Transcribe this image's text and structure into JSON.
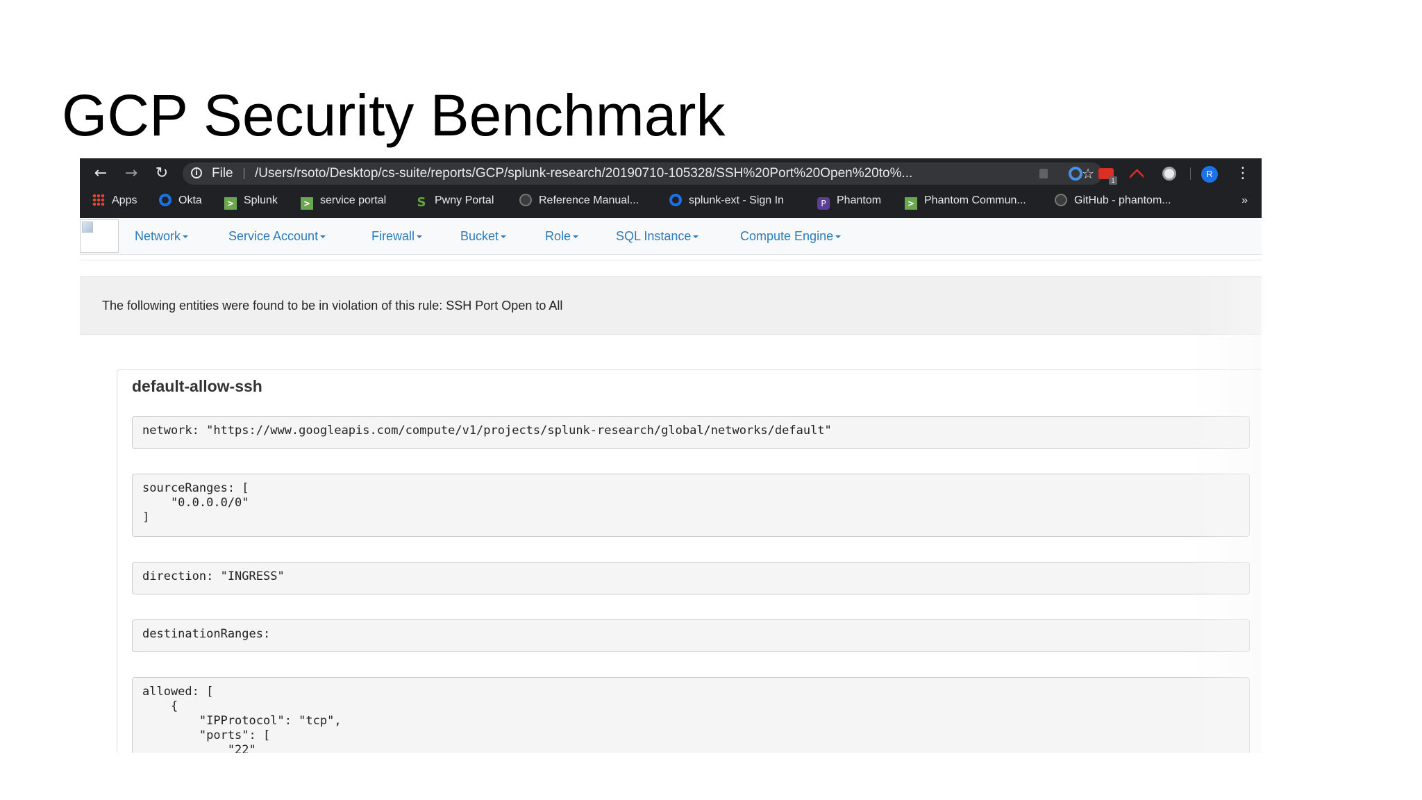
{
  "slide": {
    "title": "GCP Security Benchmark"
  },
  "browser": {
    "toolbar": {
      "back_icon": "←",
      "forward_icon": "→",
      "reload_icon": "↻",
      "file_label": "File",
      "url": "/Users/rsoto/Desktop/cs-suite/reports/GCP/splunk-research/20190710-105328/SSH%20Port%20Open%20to%...",
      "star_icon": "☆",
      "avatar_initial": "R",
      "menu_icon": "⋮",
      "extension_badge": "1"
    },
    "bookmarks": [
      {
        "label": "Apps",
        "icon": "apps-grid-icon"
      },
      {
        "label": "Okta",
        "icon": "okta-icon"
      },
      {
        "label": "Splunk",
        "icon": "splunk-green-icon"
      },
      {
        "label": "service portal",
        "icon": "green-arrow-icon"
      },
      {
        "label": "Pwny Portal",
        "icon": "splunk-s-icon"
      },
      {
        "label": "Reference Manual...",
        "icon": "github-icon"
      },
      {
        "label": "splunk-ext - Sign In",
        "icon": "okta-icon"
      },
      {
        "label": "Phantom",
        "icon": "phantom-icon"
      },
      {
        "label": "Phantom Commun...",
        "icon": "green-arrow-icon"
      },
      {
        "label": "GitHub - phantom...",
        "icon": "github-icon"
      }
    ],
    "bookmarks_more": "»"
  },
  "page": {
    "nav": [
      {
        "label": "Network"
      },
      {
        "label": "Service Account"
      },
      {
        "label": "Firewall"
      },
      {
        "label": "Bucket"
      },
      {
        "label": "Role"
      },
      {
        "label": "SQL Instance"
      },
      {
        "label": "Compute Engine"
      }
    ],
    "alert": "The following entities were found to be in violation of this rule: SSH Port Open to All",
    "card": {
      "title": "default-allow-ssh",
      "blocks": [
        "network: \"https://www.googleapis.com/compute/v1/projects/splunk-research/global/networks/default\"",
        "sourceRanges: [\n    \"0.0.0.0/0\"\n]",
        "direction: \"INGRESS\"",
        "destinationRanges:",
        "allowed: [\n    {\n        \"IPProtocol\": \"tcp\",\n        \"ports\": [\n            \"22\""
      ]
    }
  },
  "colors": {
    "chrome_dark": "#202124",
    "link_blue": "#2b7bb9",
    "alert_bg": "#f0f0f0",
    "code_bg": "#f5f5f5"
  }
}
